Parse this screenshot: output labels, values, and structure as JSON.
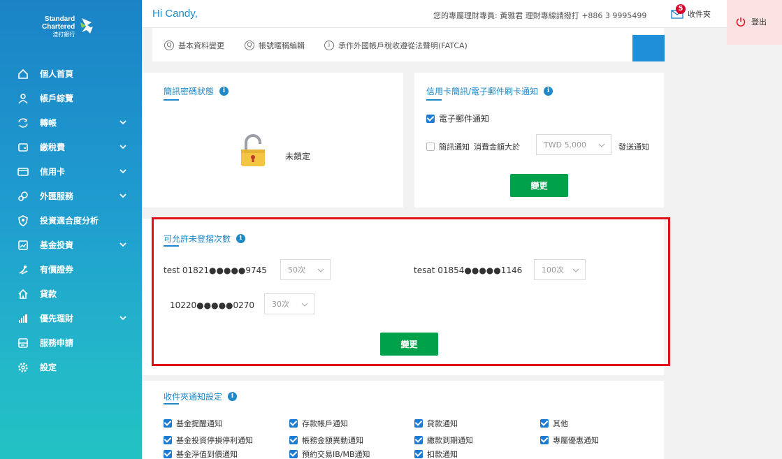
{
  "brand": {
    "line1": "Standard",
    "line2": "Chartered",
    "line3": "渣打銀行"
  },
  "sidebar": {
    "items": [
      {
        "label": "個人首頁",
        "icon": "home-icon",
        "expandable": false
      },
      {
        "label": "帳戶綜覽",
        "icon": "user-icon",
        "expandable": false
      },
      {
        "label": "轉帳",
        "icon": "transfer-icon",
        "expandable": true
      },
      {
        "label": "繳稅費",
        "icon": "bill-icon",
        "expandable": true
      },
      {
        "label": "信用卡",
        "icon": "credit-card-icon",
        "expandable": true
      },
      {
        "label": "外匯服務",
        "icon": "fx-icon",
        "expandable": true
      },
      {
        "label": "投資適合度分析",
        "icon": "shield-icon",
        "expandable": false
      },
      {
        "label": "基金投資",
        "icon": "fund-icon",
        "expandable": true
      },
      {
        "label": "有價證券",
        "icon": "securities-icon",
        "expandable": false
      },
      {
        "label": "貸款",
        "icon": "loan-icon",
        "expandable": false
      },
      {
        "label": "優先理財",
        "icon": "priority-icon",
        "expandable": true
      },
      {
        "label": "服務申請",
        "icon": "service-icon",
        "expandable": false
      },
      {
        "label": "設定",
        "icon": "settings-icon",
        "expandable": false
      }
    ]
  },
  "header": {
    "greeting": "Hi Candy,",
    "rm_info": "您的專屬理財專員: 黃雅君 理財專線請撥打 +886 3 9995499",
    "inbox_count": "5",
    "inbox_label": "收件夾",
    "logout_label": "登出"
  },
  "sublinks": [
    {
      "label": "基本資料變更",
      "icon": "Q"
    },
    {
      "label": "帳號暱稱編輯",
      "icon": "Q"
    },
    {
      "label": "承作外國帳戶稅收遵從法聲明(FATCA)",
      "icon": "i"
    }
  ],
  "sms_lock": {
    "title": "簡訊密碼狀態",
    "status": "未鎖定"
  },
  "card_notify": {
    "title": "信用卡簡訊/電子郵件刷卡通知",
    "email_label": "電子郵件通知",
    "email_checked": true,
    "sms_label": "簡訊通知",
    "sms_checked": false,
    "amount_prefix": "消費金額大於",
    "amount_value": "TWD 5,000",
    "amount_suffix": "發送通知",
    "button": "變更"
  },
  "login_attempts": {
    "title": "可允許未登摺次數",
    "accounts": [
      {
        "label": "test 01821●●●●●9745",
        "value": "50次"
      },
      {
        "label": "tesat 01854●●●●●1146",
        "value": "100次"
      },
      {
        "label": "10220●●●●●0270",
        "value": "30次"
      }
    ],
    "button": "變更"
  },
  "inbox_settings": {
    "title": "收件夾通知設定",
    "items": [
      {
        "label": "基金提醒通知",
        "checked": true
      },
      {
        "label": "存款帳戶通知",
        "checked": true
      },
      {
        "label": "貸款通知",
        "checked": true
      },
      {
        "label": "其他",
        "checked": true
      },
      {
        "label": "基金投資停損停利通知",
        "checked": true
      },
      {
        "label": "帳務金額異動通知",
        "checked": true
      },
      {
        "label": "繳款到期通知",
        "checked": true
      },
      {
        "label": "專屬優惠通知",
        "checked": true
      },
      {
        "label": "基金淨值到價通知",
        "checked": true
      },
      {
        "label": "預約交易IB/MB通知",
        "checked": true
      },
      {
        "label": "扣款通知",
        "checked": true
      }
    ]
  },
  "colors": {
    "accent": "#1e88c8",
    "green": "#00a14b",
    "highlight": "#e0101b",
    "badge": "#d6002a"
  }
}
